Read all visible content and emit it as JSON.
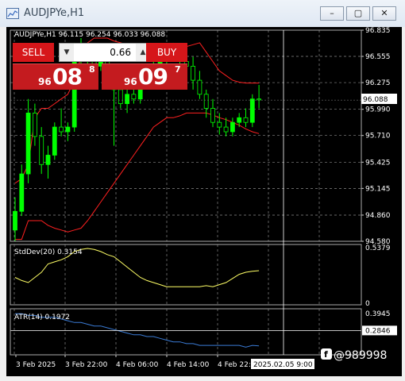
{
  "window": {
    "title": "AUDJPYe,H1",
    "buttons": {
      "minimize": "–",
      "restore": "▢",
      "close": "✕"
    }
  },
  "chart": {
    "header": "AUDJPYe,H1  96.115 96.254 96.033 96.088",
    "trade_panel": {
      "sell_label": "SELL",
      "buy_label": "BUY",
      "lot_value": "0.66",
      "sell_price": {
        "prefix": "96",
        "big": "08",
        "sup": "8"
      },
      "buy_price": {
        "prefix": "96",
        "big": "09",
        "sup": "7"
      }
    },
    "price_axis": [
      "96.835",
      "96.555",
      "96.275",
      "95.990",
      "95.710",
      "95.425",
      "95.145",
      "94.860",
      "94.580"
    ],
    "current_price": "96.088",
    "stddev_label": "StdDev(20) 0.3154",
    "stddev_axis": [
      "0.5379",
      "0"
    ],
    "atr_label": "ATR(14) 0.1972",
    "atr_axis": [
      "0.3945",
      "0.2846"
    ],
    "time_axis": [
      "3 Feb 2025",
      "3 Feb 22:00",
      "4 Feb 06:00",
      "4 Feb 14:00",
      "4 Feb 22:00"
    ],
    "crosshair_time": "2025.02.05 9:00",
    "watermark": "@989998",
    "colors": {
      "bull": "#00ff00",
      "bear": "#00ff00",
      "band": "#ff2020",
      "stddev": "#ffff66",
      "atr": "#3a7bd5",
      "grid": "#8a8a8a"
    }
  },
  "chart_data": {
    "type": "candlestick",
    "candles": [
      {
        "o": 94.7,
        "h": 95.05,
        "l": 94.58,
        "c": 94.9
      },
      {
        "o": 94.9,
        "h": 95.4,
        "l": 94.85,
        "c": 95.3
      },
      {
        "o": 95.3,
        "h": 96.1,
        "l": 95.2,
        "c": 95.95
      },
      {
        "o": 95.95,
        "h": 96.05,
        "l": 95.6,
        "c": 95.7
      },
      {
        "o": 95.7,
        "h": 95.8,
        "l": 95.3,
        "c": 95.4
      },
      {
        "o": 95.4,
        "h": 95.6,
        "l": 95.25,
        "c": 95.5
      },
      {
        "o": 95.5,
        "h": 95.85,
        "l": 95.45,
        "c": 95.8
      },
      {
        "o": 95.8,
        "h": 96.0,
        "l": 95.7,
        "c": 95.75
      },
      {
        "o": 95.75,
        "h": 95.85,
        "l": 95.65,
        "c": 95.8
      },
      {
        "o": 95.8,
        "h": 96.7,
        "l": 95.75,
        "c": 96.6
      },
      {
        "o": 96.6,
        "h": 96.75,
        "l": 96.45,
        "c": 96.55
      },
      {
        "o": 96.55,
        "h": 96.65,
        "l": 96.4,
        "c": 96.5
      },
      {
        "o": 96.5,
        "h": 96.6,
        "l": 96.35,
        "c": 96.45
      },
      {
        "o": 96.45,
        "h": 96.55,
        "l": 96.4,
        "c": 96.5
      },
      {
        "o": 96.5,
        "h": 96.6,
        "l": 96.35,
        "c": 96.4
      },
      {
        "o": 96.4,
        "h": 96.45,
        "l": 95.6,
        "c": 96.2
      },
      {
        "o": 96.2,
        "h": 96.35,
        "l": 96.0,
        "c": 96.05
      },
      {
        "o": 96.05,
        "h": 96.2,
        "l": 95.95,
        "c": 96.15
      },
      {
        "o": 96.15,
        "h": 96.25,
        "l": 96.05,
        "c": 96.1
      },
      {
        "o": 96.1,
        "h": 96.4,
        "l": 96.05,
        "c": 96.3
      },
      {
        "o": 96.3,
        "h": 96.45,
        "l": 96.2,
        "c": 96.35
      },
      {
        "o": 96.35,
        "h": 96.5,
        "l": 96.3,
        "c": 96.45
      },
      {
        "o": 96.45,
        "h": 96.6,
        "l": 96.4,
        "c": 96.55
      },
      {
        "o": 96.55,
        "h": 96.65,
        "l": 96.45,
        "c": 96.6
      },
      {
        "o": 96.6,
        "h": 96.7,
        "l": 96.5,
        "c": 96.55
      },
      {
        "o": 96.55,
        "h": 96.65,
        "l": 96.45,
        "c": 96.5
      },
      {
        "o": 96.5,
        "h": 96.6,
        "l": 96.4,
        "c": 96.45
      },
      {
        "o": 96.45,
        "h": 96.55,
        "l": 96.2,
        "c": 96.3
      },
      {
        "o": 96.3,
        "h": 96.4,
        "l": 96.1,
        "c": 96.15
      },
      {
        "o": 96.15,
        "h": 96.2,
        "l": 95.9,
        "c": 96.0
      },
      {
        "o": 96.0,
        "h": 96.1,
        "l": 95.8,
        "c": 95.85
      },
      {
        "o": 95.85,
        "h": 95.95,
        "l": 95.72,
        "c": 95.8
      },
      {
        "o": 95.8,
        "h": 95.9,
        "l": 95.7,
        "c": 95.75
      },
      {
        "o": 95.75,
        "h": 95.9,
        "l": 95.7,
        "c": 95.85
      },
      {
        "o": 95.85,
        "h": 95.95,
        "l": 95.8,
        "c": 95.9
      },
      {
        "o": 95.9,
        "h": 96.0,
        "l": 95.8,
        "c": 95.85
      },
      {
        "o": 95.85,
        "h": 96.15,
        "l": 95.8,
        "c": 96.1
      },
      {
        "o": 96.1,
        "h": 96.25,
        "l": 96.0,
        "c": 96.09
      }
    ],
    "upper_band": [
      95.2,
      95.25,
      95.4,
      95.9,
      96.0,
      96.0,
      96.05,
      96.1,
      96.15,
      96.3,
      96.55,
      96.7,
      96.75,
      96.75,
      96.75,
      96.72,
      96.7,
      96.68,
      96.65,
      96.62,
      96.6,
      96.6,
      96.6,
      96.6,
      96.62,
      96.64,
      96.66,
      96.68,
      96.7,
      96.6,
      96.5,
      96.4,
      96.35,
      96.3,
      96.28,
      96.27,
      96.27,
      96.27
    ],
    "lower_band": [
      94.6,
      94.6,
      94.8,
      94.8,
      94.8,
      94.75,
      94.72,
      94.7,
      94.68,
      94.7,
      94.72,
      94.8,
      94.9,
      95.0,
      95.1,
      95.2,
      95.3,
      95.4,
      95.5,
      95.6,
      95.7,
      95.8,
      95.85,
      95.9,
      95.9,
      95.92,
      95.95,
      95.95,
      95.95,
      95.95,
      95.93,
      95.9,
      95.88,
      95.85,
      95.82,
      95.78,
      95.75,
      95.73
    ],
    "stddev": [
      0.25,
      0.22,
      0.2,
      0.25,
      0.3,
      0.38,
      0.4,
      0.42,
      0.45,
      0.5,
      0.52,
      0.53,
      0.52,
      0.5,
      0.47,
      0.45,
      0.4,
      0.35,
      0.3,
      0.25,
      0.22,
      0.2,
      0.18,
      0.16,
      0.16,
      0.16,
      0.16,
      0.16,
      0.16,
      0.17,
      0.16,
      0.18,
      0.2,
      0.24,
      0.28,
      0.3,
      0.31,
      0.3154
    ],
    "atr": [
      0.38,
      0.38,
      0.37,
      0.37,
      0.36,
      0.36,
      0.36,
      0.35,
      0.34,
      0.33,
      0.33,
      0.32,
      0.31,
      0.31,
      0.3,
      0.29,
      0.28,
      0.27,
      0.26,
      0.26,
      0.25,
      0.25,
      0.24,
      0.23,
      0.22,
      0.22,
      0.21,
      0.21,
      0.2,
      0.2,
      0.2,
      0.2,
      0.2,
      0.2,
      0.2,
      0.19,
      0.2,
      0.1972
    ],
    "ylim": [
      94.58,
      96.835
    ],
    "stddev_ylim": [
      0,
      0.5379
    ],
    "atr_ylim": [
      0.16,
      0.3945
    ]
  }
}
